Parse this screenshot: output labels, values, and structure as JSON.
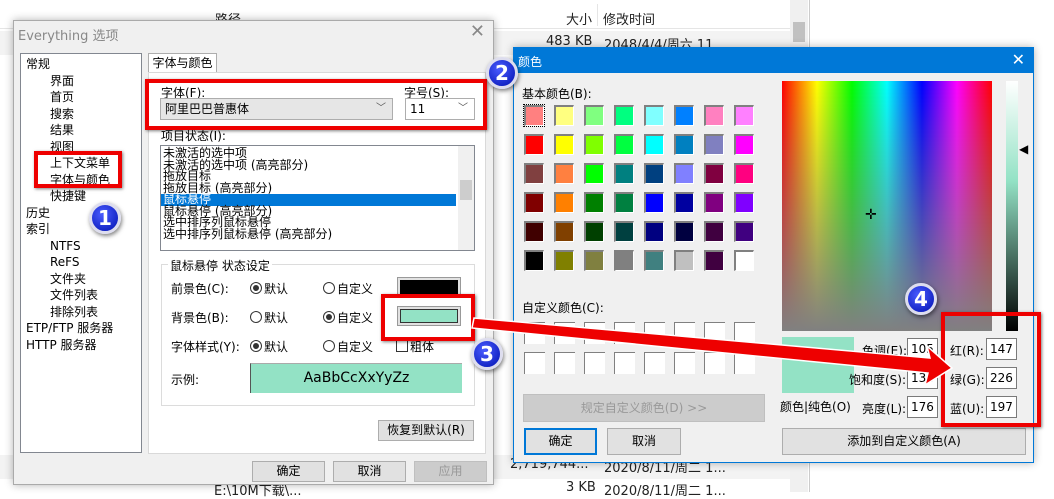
{
  "background_list": {
    "columns": [
      "路径",
      "大小",
      "修改时间"
    ],
    "rows": [
      {
        "size": "483 KB",
        "modified": "2048/4/4/周六 11..."
      },
      {
        "size": "2,719,744...",
        "modified": "2020/8/11/周二 1..."
      },
      {
        "size": "3 KB",
        "modified": "2020/8/11/周二 1..."
      }
    ],
    "partial_path": "E:\\10M下载\\..."
  },
  "options_dialog": {
    "title": "Everything 选项",
    "tree": [
      {
        "label": "常规",
        "level": 0
      },
      {
        "label": "界面",
        "level": 1
      },
      {
        "label": "首页",
        "level": 1
      },
      {
        "label": "搜索",
        "level": 1
      },
      {
        "label": "结果",
        "level": 1
      },
      {
        "label": "视图",
        "level": 1
      },
      {
        "label": "上下文菜单",
        "level": 1
      },
      {
        "label": "字体与颜色",
        "level": 1
      },
      {
        "label": "快捷键",
        "level": 1
      },
      {
        "label": "历史",
        "level": 0
      },
      {
        "label": "索引",
        "level": 0
      },
      {
        "label": "NTFS",
        "level": 1
      },
      {
        "label": "ReFS",
        "level": 1
      },
      {
        "label": "文件夹",
        "level": 1
      },
      {
        "label": "文件列表",
        "level": 1
      },
      {
        "label": "排除列表",
        "level": 1
      },
      {
        "label": "ETP/FTP 服务器",
        "level": 0
      },
      {
        "label": "HTTP 服务器",
        "level": 0
      }
    ],
    "tab": "字体与颜色",
    "font_label": "字体(F):",
    "font_value": "阿里巴巴普惠体",
    "size_label": "字号(S):",
    "size_value": "11",
    "item_state_label": "项目状态(I):",
    "item_states": [
      "未激活的选中项",
      "未激活的选中项 (高亮部分)",
      "拖放目标",
      "拖放目标 (高亮部分)",
      "鼠标悬停",
      "鼠标悬停 (高亮部分)",
      "选中排序列鼠标悬停",
      "选中排序列鼠标悬停 (高亮部分)"
    ],
    "selected_state": "鼠标悬停",
    "group_title": "鼠标悬停 状态设定",
    "foreground_label": "前景色(C):",
    "background_label": "背景色(B):",
    "fontstyle_label": "字体样式(Y):",
    "default_label": "默认",
    "custom_label": "自定义",
    "bold_label": "粗体",
    "foreground_color": "#000000",
    "background_color": "#93E2C5",
    "sample_label": "示例:",
    "sample_text": "AaBbCcXxYyZz",
    "restore_label": "恢复到默认(R)",
    "ok": "确定",
    "cancel": "取消",
    "apply": "应用"
  },
  "color_dialog": {
    "title": "颜色",
    "basic_label": "基本颜色(B):",
    "basic_colors": [
      "#FF8080",
      "#FFFF80",
      "#80FF80",
      "#00FF80",
      "#80FFFF",
      "#0080FF",
      "#FF80C0",
      "#FF80FF",
      "#FF0000",
      "#FFFF00",
      "#80FF00",
      "#00FF40",
      "#00FFFF",
      "#0080C0",
      "#8080C0",
      "#FF00FF",
      "#804040",
      "#FF8040",
      "#00FF00",
      "#008080",
      "#004080",
      "#8080FF",
      "#800040",
      "#FF0080",
      "#800000",
      "#FF8000",
      "#008000",
      "#008040",
      "#0000FF",
      "#0000A0",
      "#800080",
      "#8000FF",
      "#400000",
      "#804000",
      "#004000",
      "#004040",
      "#000080",
      "#000040",
      "#400040",
      "#400080",
      "#000000",
      "#808000",
      "#808040",
      "#808080",
      "#408080",
      "#C0C0C0",
      "#400040",
      "#FFFFFF"
    ],
    "custom_label": "自定义颜色(C):",
    "define_custom": "规定自定义颜色(D) >>",
    "ok": "确定",
    "cancel": "取消",
    "solid_label": "颜色|纯色(O)",
    "hue_label": "色调(E):",
    "hue": "105",
    "sat_label": "饱和度(S):",
    "sat": "138",
    "lum_label": "亮度(L):",
    "lum": "176",
    "red_label": "红(R):",
    "red": "147",
    "green_label": "绿(G):",
    "green": "226",
    "blue_label": "蓝(U):",
    "blue": "197",
    "add_custom": "添加到自定义颜色(A)",
    "current_color": "#93E2C5"
  },
  "annotations": [
    "1",
    "2",
    "3",
    "4"
  ],
  "accent": "#0078D7",
  "highlight_red": "#E00000"
}
